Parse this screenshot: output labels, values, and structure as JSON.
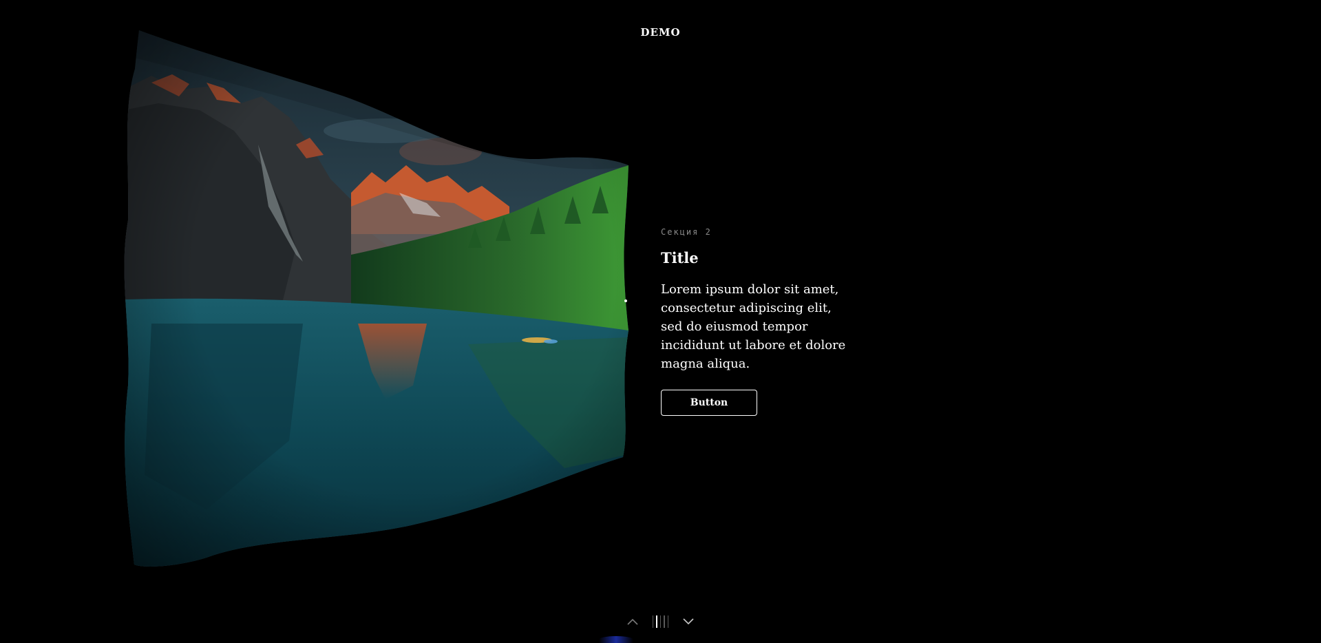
{
  "header": {
    "logo_text": "DEMO"
  },
  "hero_image": {
    "subject": "mountain-lake-landscape",
    "colors": {
      "sky": "#2a3c48",
      "mountain_peak": "#c8532c",
      "forest": "#2f7a2e",
      "lake": "#0f4a56"
    }
  },
  "section": {
    "label": "Секция 2",
    "title": "Title",
    "body": "Lorem ipsum dolor sit amet, consectetur adipiscing elit, sed do eiusmod tempor incididunt ut labore et dolore magna aliqua.",
    "button_label": "Button"
  },
  "navigation": {
    "prev_icon": "chevron-up-icon",
    "next_icon": "chevron-down-icon",
    "page_count": 5,
    "active_index": 1
  }
}
